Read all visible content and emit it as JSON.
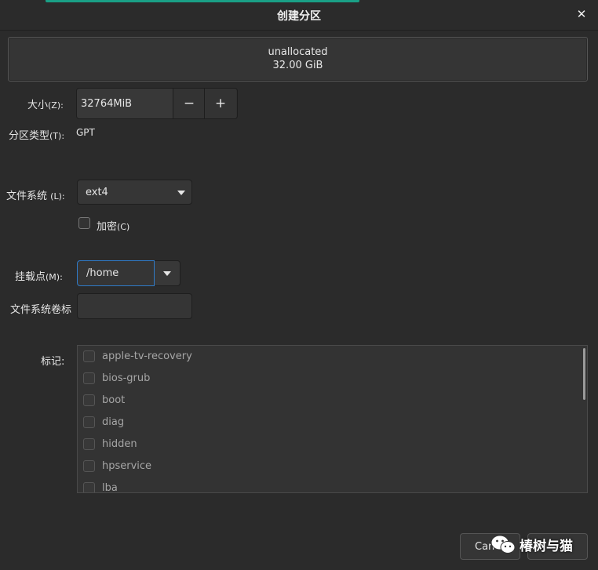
{
  "window": {
    "title": "创建分区"
  },
  "overview": {
    "line1": "unallocated",
    "line2": "32.00 GiB"
  },
  "size": {
    "label": "大小",
    "accel": "(Z):",
    "value": "32764MiB",
    "minus": "−",
    "plus": "+"
  },
  "partition_type": {
    "label": "分区类型",
    "accel": "(T):",
    "value": "GPT"
  },
  "filesystem": {
    "label": "文件系统",
    "accel": "(L):",
    "value": "ext4"
  },
  "encrypt": {
    "label": "加密",
    "accel": "(C)",
    "checked": false
  },
  "mount_point": {
    "label": "挂载点",
    "accel": "(M):",
    "value": "/home"
  },
  "fs_label": {
    "label": "文件系统卷标",
    "value": ""
  },
  "flags": {
    "label": "标记:",
    "items": [
      {
        "name": "apple-tv-recovery",
        "checked": false
      },
      {
        "name": "bios-grub",
        "checked": false
      },
      {
        "name": "boot",
        "checked": false
      },
      {
        "name": "diag",
        "checked": false
      },
      {
        "name": "hidden",
        "checked": false
      },
      {
        "name": "hpservice",
        "checked": false
      },
      {
        "name": "lba",
        "checked": false
      }
    ]
  },
  "buttons": {
    "cancel": "Canc"
  },
  "watermark": {
    "text": "椿树与猫"
  },
  "colors": {
    "accent": "#1aa086",
    "focus": "#2f7ac7",
    "background": "#2b2b2b"
  }
}
